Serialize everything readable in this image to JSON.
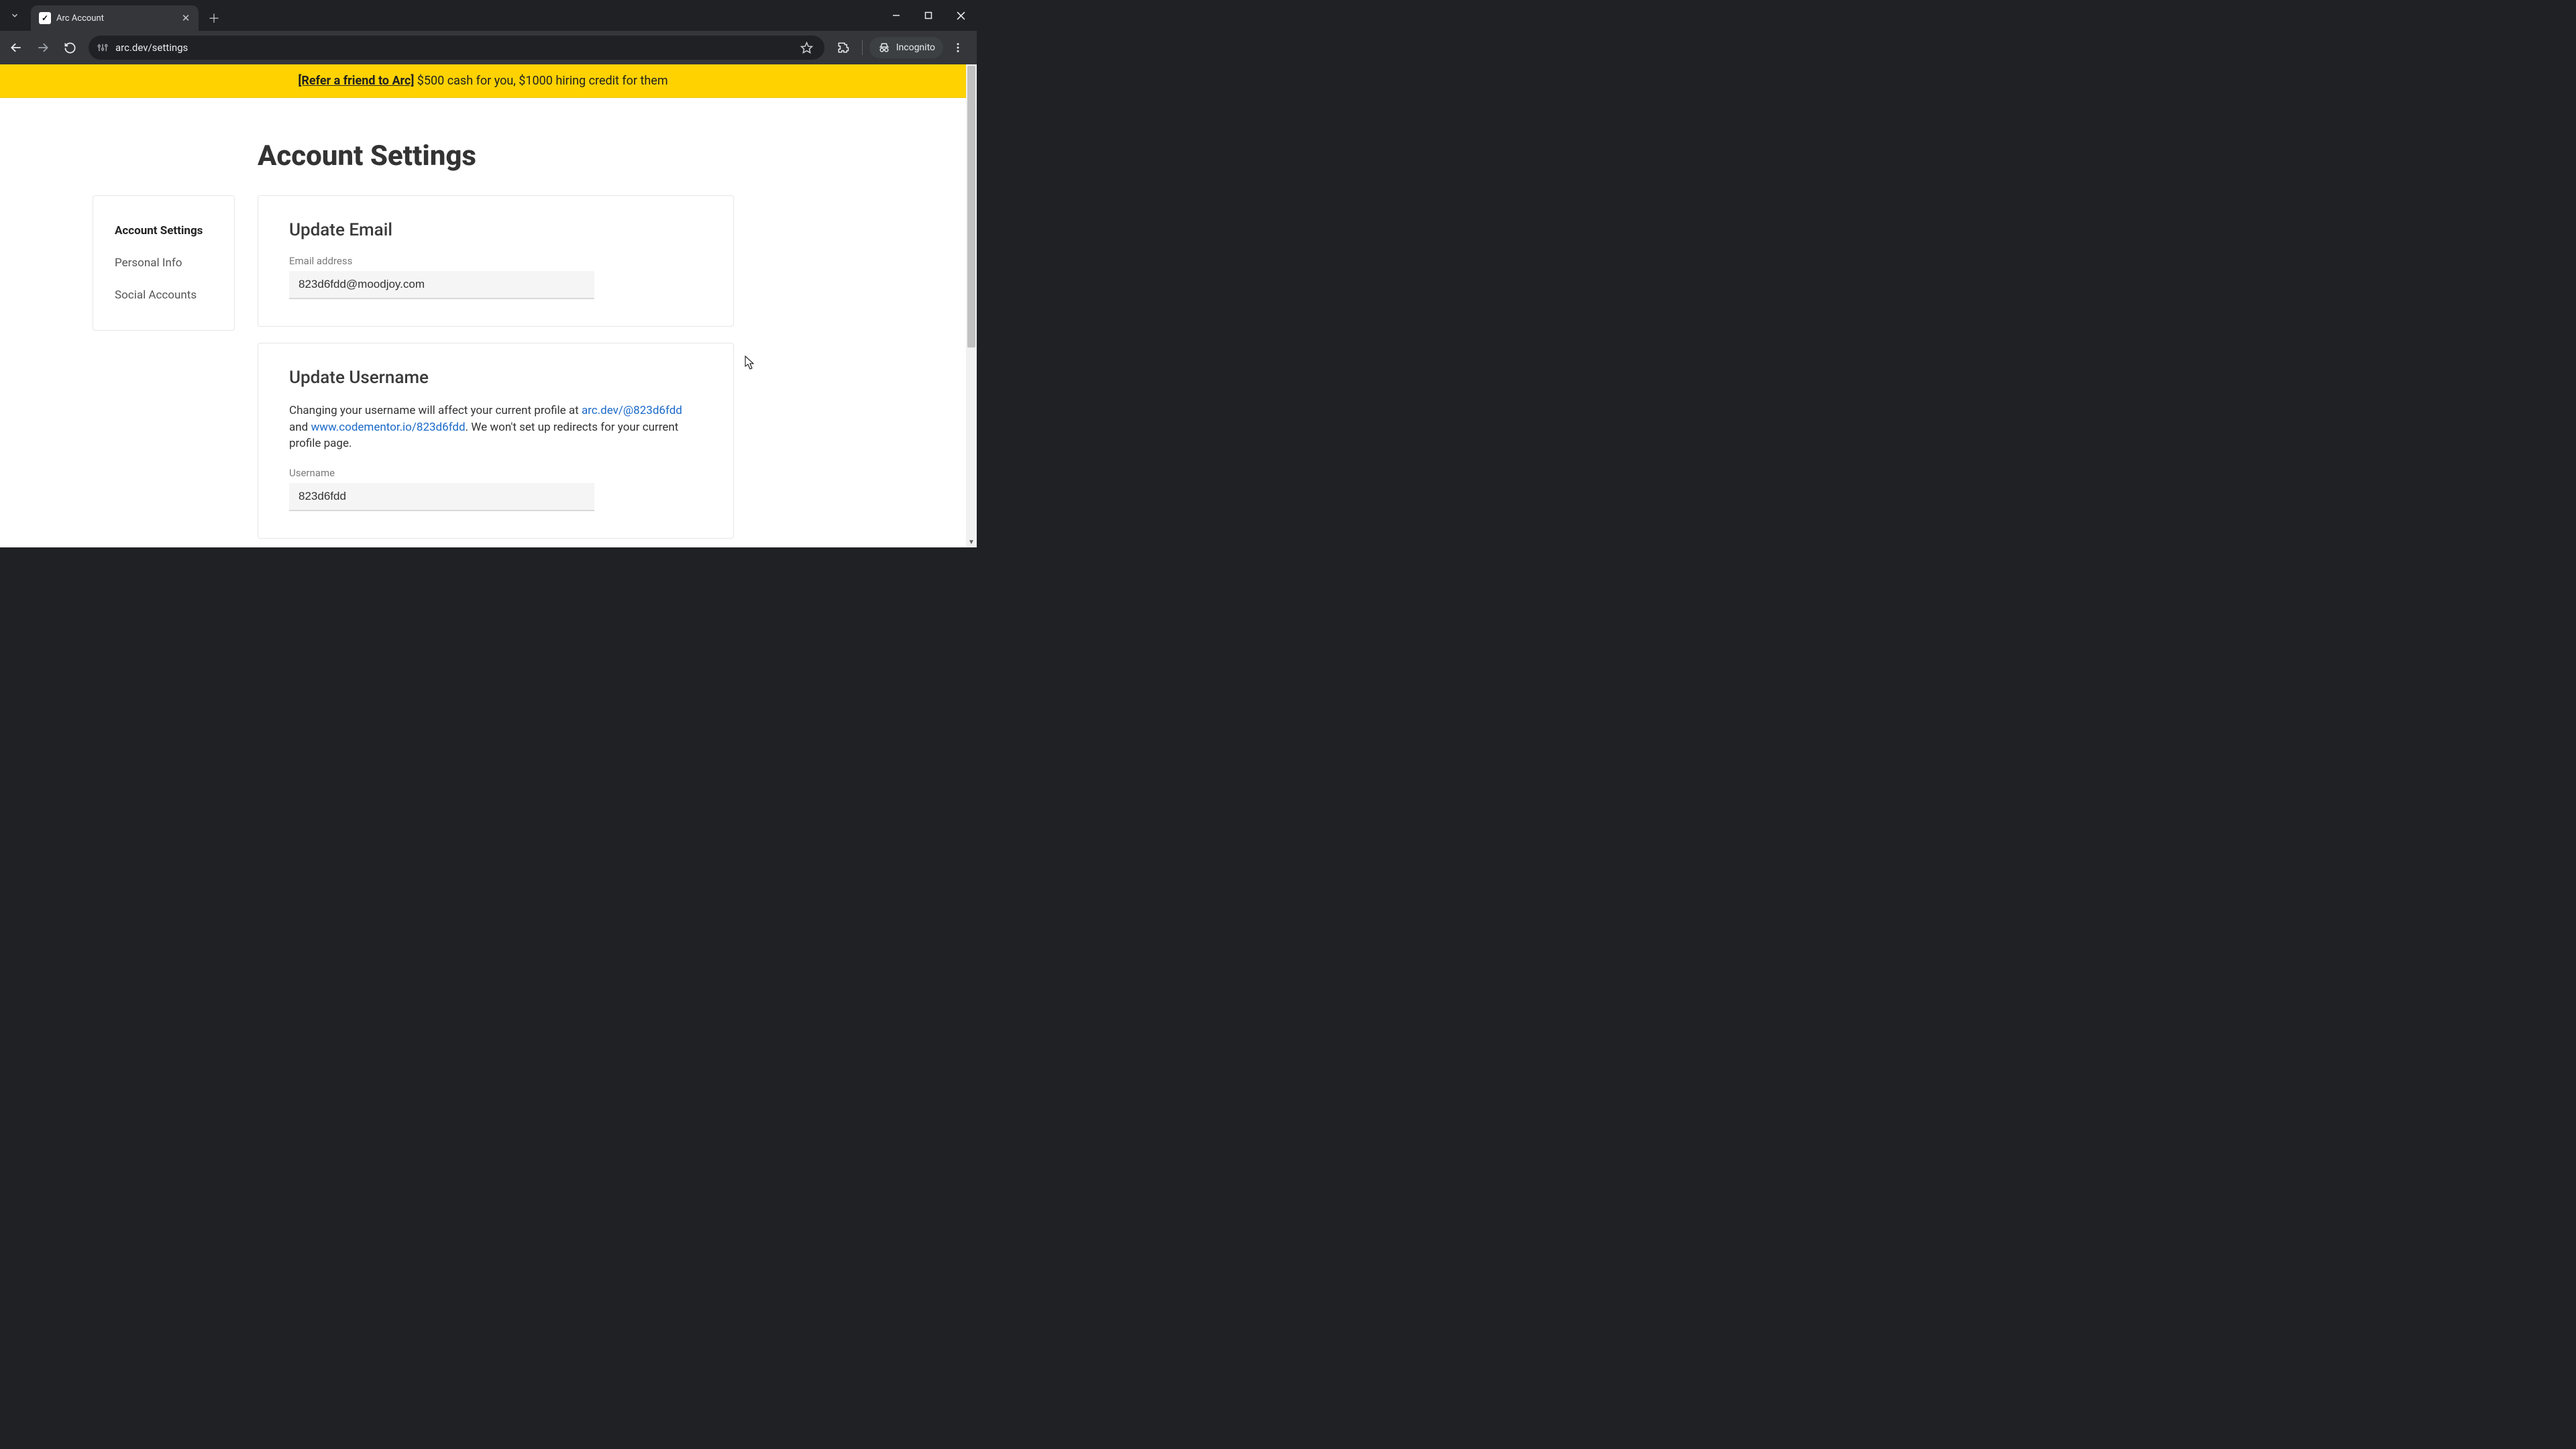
{
  "browser": {
    "tab_title": "Arc Account",
    "url": "arc.dev/settings",
    "incognito_label": "Incognito"
  },
  "banner": {
    "link_text": "[Refer a friend to Arc]",
    "rest_text": " $500 cash for you, $1000 hiring credit for them"
  },
  "page": {
    "title": "Account Settings"
  },
  "sidebar": {
    "items": [
      {
        "label": "Account Settings",
        "active": true
      },
      {
        "label": "Personal Info",
        "active": false
      },
      {
        "label": "Social Accounts",
        "active": false
      }
    ]
  },
  "email_card": {
    "heading": "Update Email",
    "field_label": "Email address",
    "value": "823d6fdd@moodjoy.com"
  },
  "username_card": {
    "heading": "Update Username",
    "desc_prefix": "Changing your username will affect your current profile at ",
    "arc_link": "arc.dev/@823d6fdd",
    "desc_mid": " and ",
    "cm_link": "www.codementor.io/823d6fdd",
    "desc_suffix": ". We won't set up redirects for your current profile page.",
    "field_label": "Username",
    "value": "823d6fdd"
  }
}
